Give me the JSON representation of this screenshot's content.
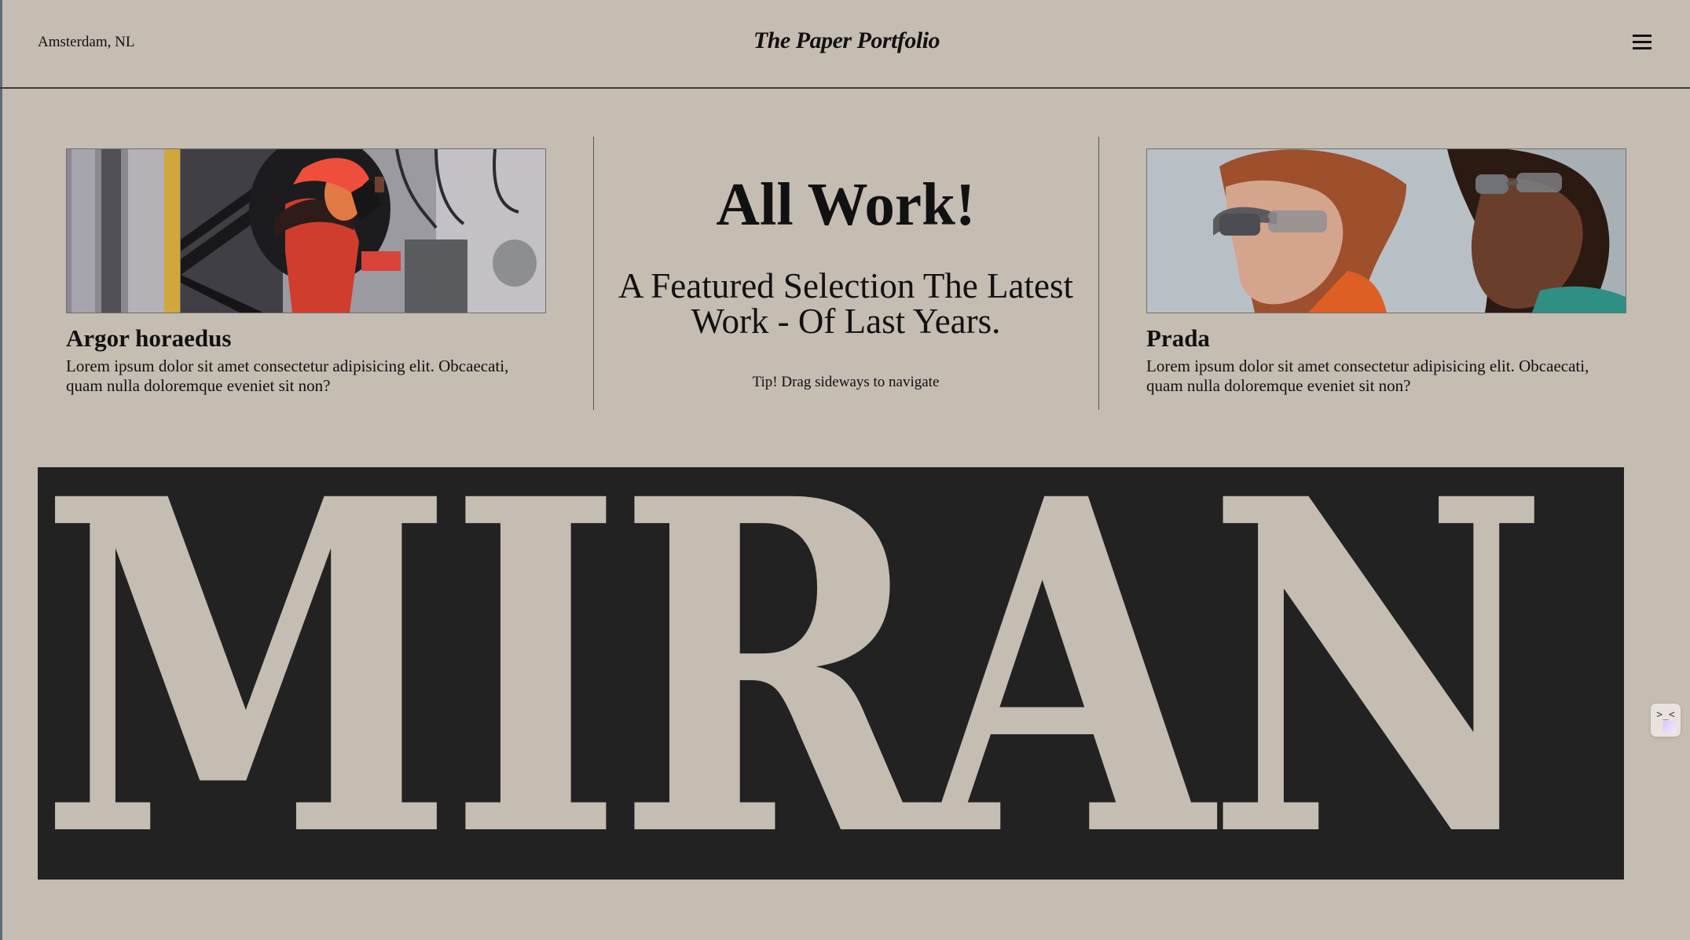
{
  "header": {
    "location": "Amsterdam, NL",
    "brand": "The Paper Portfolio",
    "menu_icon": "hamburger-menu-icon"
  },
  "cards": [
    {
      "title": "Argor horaedus",
      "description": "Lorem ipsum dolor sit amet consectetur adipisicing elit. Obcaecati, quam nulla doloremque eveniet sit non?"
    },
    {
      "title": "Prada",
      "description": "Lorem ipsum dolor sit amet consectetur adipisicing elit. Obcaecati, quam nulla doloremque eveniet sit non?"
    }
  ],
  "feature": {
    "title": "All Work!",
    "subtitle": "A Featured Selection The Latest Work - Of Last Years.",
    "tip": "Tip! Drag sideways to navigate"
  },
  "banner": {
    "word": "MIRAN"
  },
  "colors": {
    "background": "#c5bcb2",
    "ink": "#111111",
    "banner": "#222222"
  }
}
